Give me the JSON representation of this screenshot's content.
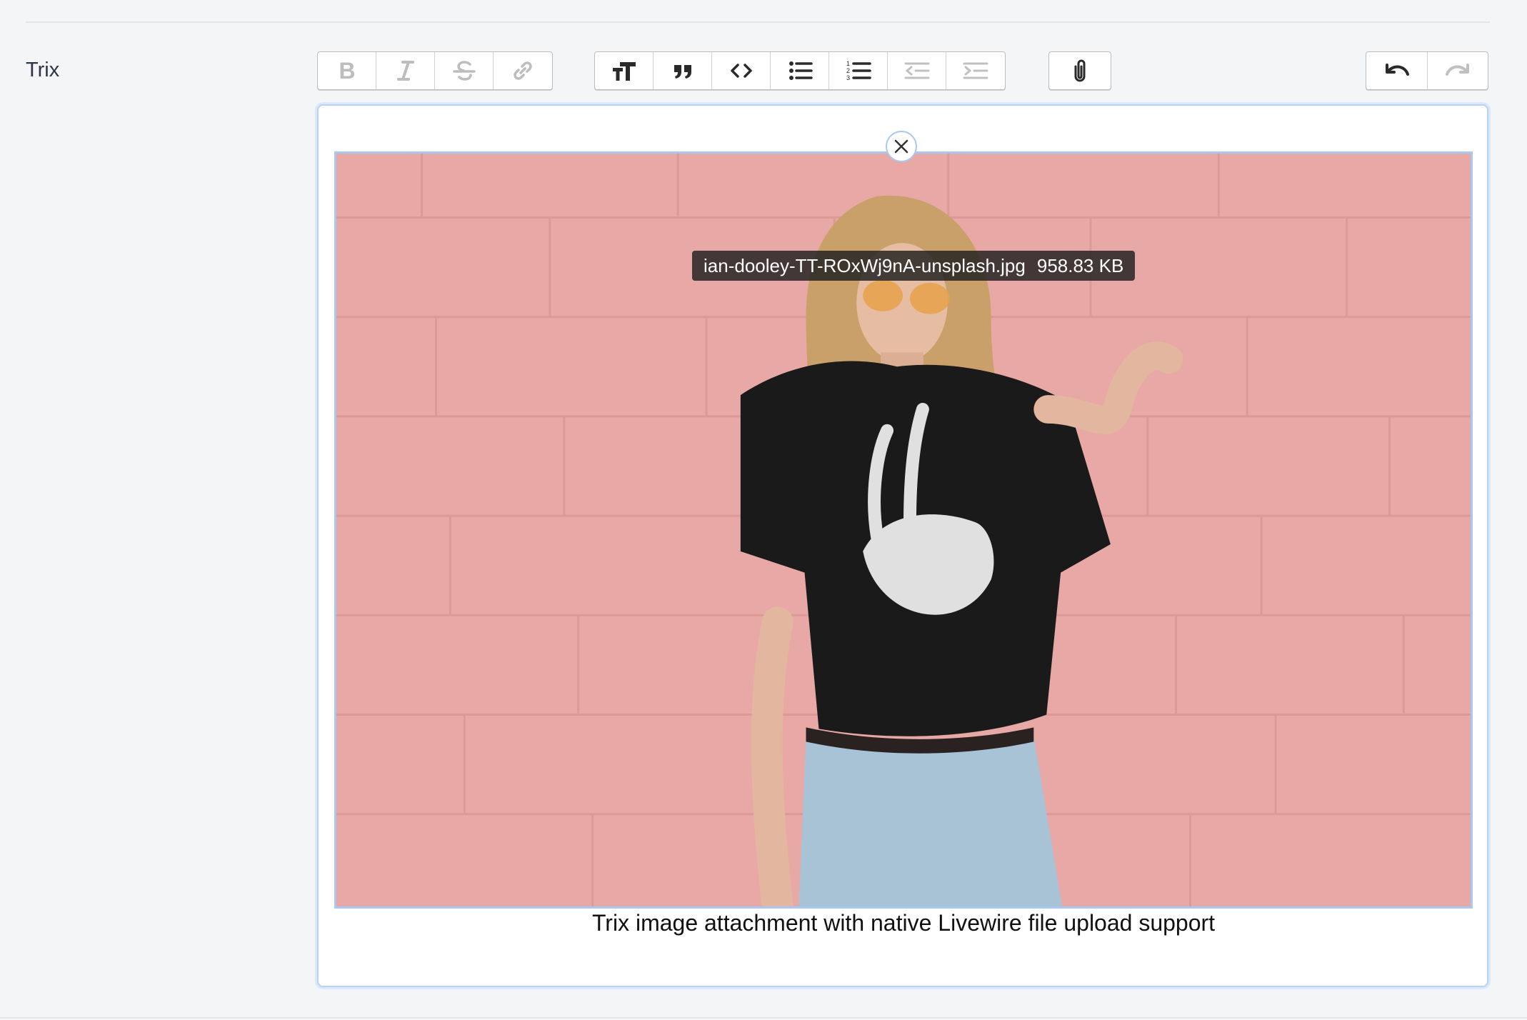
{
  "field": {
    "label": "Trix"
  },
  "toolbar": {
    "text_tools": [
      {
        "name": "bold",
        "icon": "bold-icon",
        "enabled": false
      },
      {
        "name": "italic",
        "icon": "italic-icon",
        "enabled": false
      },
      {
        "name": "strike",
        "icon": "strikethrough-icon",
        "enabled": false
      },
      {
        "name": "link",
        "icon": "link-icon",
        "enabled": false
      }
    ],
    "block_tools": [
      {
        "name": "heading",
        "icon": "heading-icon",
        "enabled": true
      },
      {
        "name": "quote",
        "icon": "quote-icon",
        "enabled": true
      },
      {
        "name": "code",
        "icon": "code-icon",
        "enabled": true
      },
      {
        "name": "bullet-list",
        "icon": "bullet-list-icon",
        "enabled": true
      },
      {
        "name": "number-list",
        "icon": "number-list-icon",
        "enabled": true
      },
      {
        "name": "decrease-indent",
        "icon": "outdent-icon",
        "enabled": false
      },
      {
        "name": "increase-indent",
        "icon": "indent-icon",
        "enabled": false
      }
    ],
    "file_tools": [
      {
        "name": "attach",
        "icon": "paperclip-icon",
        "enabled": true
      }
    ],
    "history_tools": [
      {
        "name": "undo",
        "icon": "undo-icon",
        "enabled": true
      },
      {
        "name": "redo",
        "icon": "redo-icon",
        "enabled": false
      }
    ]
  },
  "attachment": {
    "filename": "ian-dooley-TT-ROxWj9nA-unsplash.jpg",
    "filesize": "958.83 KB",
    "caption": "Trix image attachment with native Livewire file upload support"
  },
  "colors": {
    "background": "#f4f5f7",
    "focus_border": "#b6d2f5",
    "wall_pink": "#e8a8a5",
    "enabled_icon": "#2a2a2a",
    "disabled_icon": "#b8b8b8"
  }
}
